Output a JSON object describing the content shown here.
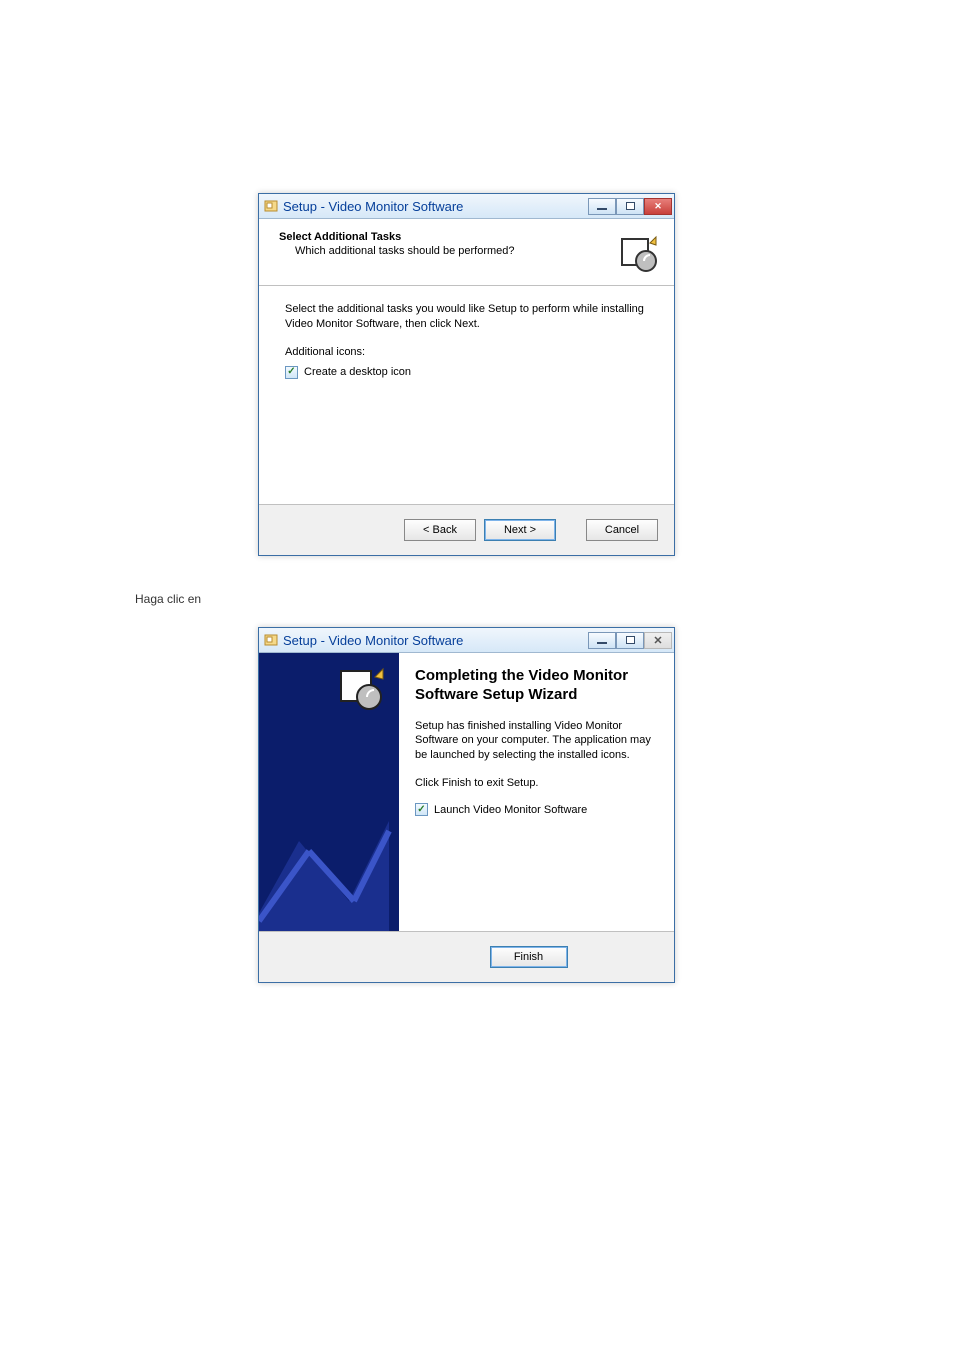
{
  "page": {
    "caption": "Haga clic en"
  },
  "dialog1": {
    "title": "Setup - Video Monitor Software",
    "header_title": "Select Additional Tasks",
    "header_sub": "Which additional tasks should be performed?",
    "instruction": "Select the additional tasks you would like Setup to perform while installing Video Monitor Software, then click Next.",
    "group_label": "Additional icons:",
    "checkbox_label": "Create a desktop icon",
    "checkbox_checked": true,
    "buttons": {
      "back": "< Back",
      "next": "Next >",
      "cancel": "Cancel"
    }
  },
  "dialog2": {
    "title": "Setup - Video Monitor Software",
    "heading": "Completing the Video Monitor Software Setup Wizard",
    "para": "Setup has finished installing Video Monitor Software on your computer. The application may be launched by selecting the installed icons.",
    "para2": "Click Finish to exit Setup.",
    "checkbox_label": "Launch Video Monitor Software",
    "checkbox_checked": true,
    "buttons": {
      "finish": "Finish"
    }
  }
}
